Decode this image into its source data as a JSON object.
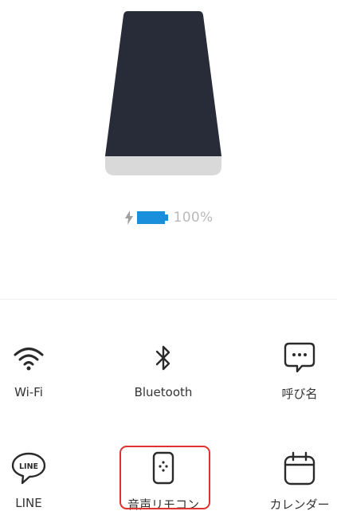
{
  "battery": {
    "level_text": "100%",
    "level": 100,
    "color": "#1a8fdc",
    "charging": true
  },
  "device": {
    "body_color": "#282c38",
    "base_color": "#d9d9d9"
  },
  "menu": {
    "items": [
      {
        "label": "Wi-Fi",
        "icon": "wifi-icon"
      },
      {
        "label": "Bluetooth",
        "icon": "bluetooth-icon"
      },
      {
        "label": "呼び名",
        "icon": "chat-bubble-icon"
      },
      {
        "label": "LINE",
        "icon": "line-icon"
      },
      {
        "label": "音声リモコン",
        "icon": "remote-control-icon",
        "highlighted": true
      },
      {
        "label": "カレンダー",
        "icon": "calendar-icon"
      }
    ],
    "highlight_color": "#e0322f"
  }
}
